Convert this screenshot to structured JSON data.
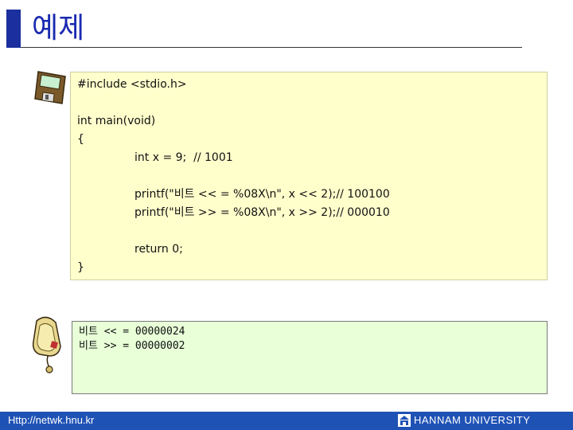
{
  "slide": {
    "title": "예제"
  },
  "code": {
    "lines": [
      "#include <stdio.h>",
      "int main(void)",
      "{",
      "int x = 9;  // 1001",
      "printf(\"비트 << = %08X\\n\", x << 2);// 100100",
      "printf(\"비트 >> = %08X\\n\", x >> 2);// 000010",
      "return 0;",
      "}"
    ]
  },
  "output": {
    "lines": [
      "비트 << = 00000024",
      "비트 >> = 00000002"
    ]
  },
  "footer": {
    "url": "Http://netwk.hnu.kr",
    "university": "HANNAM UNIVERSITY"
  },
  "icons": {
    "code_icon": "floppy-disk-icon",
    "output_icon": "mouse-icon",
    "footer_logo": "university-logo-icon"
  },
  "colors": {
    "title_accent": "#1b2f9e",
    "code_bg": "#ffffcc",
    "output_bg": "#e8ffd8",
    "footer_bg": "#1f52b5"
  }
}
